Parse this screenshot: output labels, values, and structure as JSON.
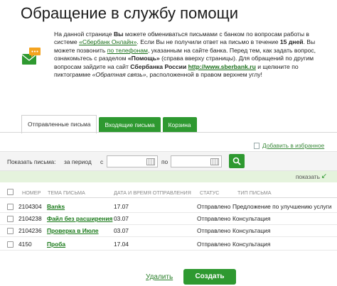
{
  "page": {
    "title": "Обращение в службу помощи"
  },
  "info": {
    "t1": "На данной странице ",
    "t1b": "Вы",
    "t2": " можете обмениваться письмами с банком по вопросам работы в системе ",
    "link_sbol": "«Сбербанк Онлайн»",
    "t3": ". Если Вы не получили ответ на письмо в течение ",
    "t3b": "15 дней",
    "t4": ". Вы можете позвонить ",
    "link_phone": "по телефонам",
    "t5": ", указанным на сайте банка. Перед тем, как задать вопрос, ознакомьтесь с разделом ",
    "t5b": "«Помощь»",
    "t6": " (справа вверху страницы). Для обращений по другим вопросам зайдите на сайт ",
    "t6b": "Сбербанка России",
    "link_site": "http://www.sberbank.ru",
    "t7": " и щелкните по пиктограмме ",
    "t7i": "«Обратная связь»",
    "t8": ", расположенной в правом верхнем углу!"
  },
  "tabs": [
    {
      "label": "Отправленные письма"
    },
    {
      "label": "Входящие письма"
    },
    {
      "label": "Корзина"
    }
  ],
  "favorites": {
    "label": "Добавить в избранное"
  },
  "filter": {
    "show_letters": "Показать письма:",
    "for_period": "за период",
    "from": "с",
    "to": "по",
    "from_value": "",
    "to_value": ""
  },
  "show": {
    "label": "показать"
  },
  "table": {
    "headers": [
      "НОМЕР",
      "ТЕМА ПИСЬМА",
      "ДАТА И ВРЕМЯ ОТПРАВЛЕНИЯ",
      "СТАТУС",
      "ТИП ПИСЬМА"
    ],
    "rows": [
      {
        "number": "2104304",
        "subject": "Banks",
        "date": "17.07",
        "status": "Отправлено",
        "type": "Предложение по улучшению услуги"
      },
      {
        "number": "2104238",
        "subject": "Файл без расширения",
        "date": "03.07",
        "status": "Отправлено",
        "type": "Консультация"
      },
      {
        "number": "2104236",
        "subject": "Проверка в Июле",
        "date": "03.07",
        "status": "Отправлено",
        "type": "Консультация"
      },
      {
        "number": "4150",
        "subject": "Проба",
        "date": "17.04",
        "status": "Отправлено",
        "type": "Консультация"
      }
    ]
  },
  "actions": {
    "delete": "Удалить",
    "create": "Создать"
  },
  "colors": {
    "accent": "#2e9930",
    "link": "#1a7a1a",
    "highlight": "#e5f3dd"
  },
  "icons": {
    "info": "envelope-chat-icon",
    "calendar": "calendar-icon",
    "search": "search-icon",
    "favorite": "bookmark-icon",
    "show": "arrow-down-left-icon"
  }
}
